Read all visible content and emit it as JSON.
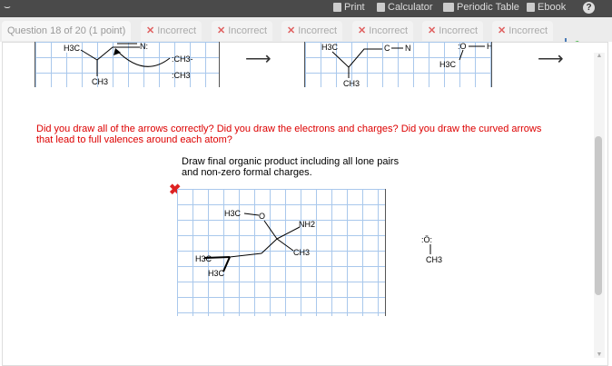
{
  "toolbar": {
    "print": "Print",
    "calculator": "Calculator",
    "periodic_table": "Periodic Table",
    "ebook": "Ebook",
    "help": "?"
  },
  "tabs": {
    "question": "Question 18 of 20 (1 point)",
    "attempts": [
      "Incorrect",
      "Incorrect",
      "Incorrect",
      "Incorrect",
      "Incorrect",
      "Incorrect"
    ]
  },
  "mechanism": {
    "step1": {
      "labels": [
        "H3C",
        "N:",
        "CH3",
        "CH3-"
      ],
      "nucleophile": ":CH3"
    },
    "step2": {
      "labels": [
        "H3C",
        "C",
        "N",
        "CH3",
        ":O",
        "H",
        "H3C"
      ]
    }
  },
  "prompt": "Did you draw all of the arrows correctly? Did you draw the electrons and charges?  Did you draw the curved arrows that lead to full valences around each atom?",
  "instruction": "Draw final organic product including all lone pairs and non-zero formal charges.",
  "answer": {
    "labels": [
      "H3C",
      "O",
      "NH2",
      "CH3",
      "H3C",
      "H3C"
    ]
  },
  "byproduct": {
    "labels": [
      ":Ö:",
      "CH3"
    ]
  }
}
